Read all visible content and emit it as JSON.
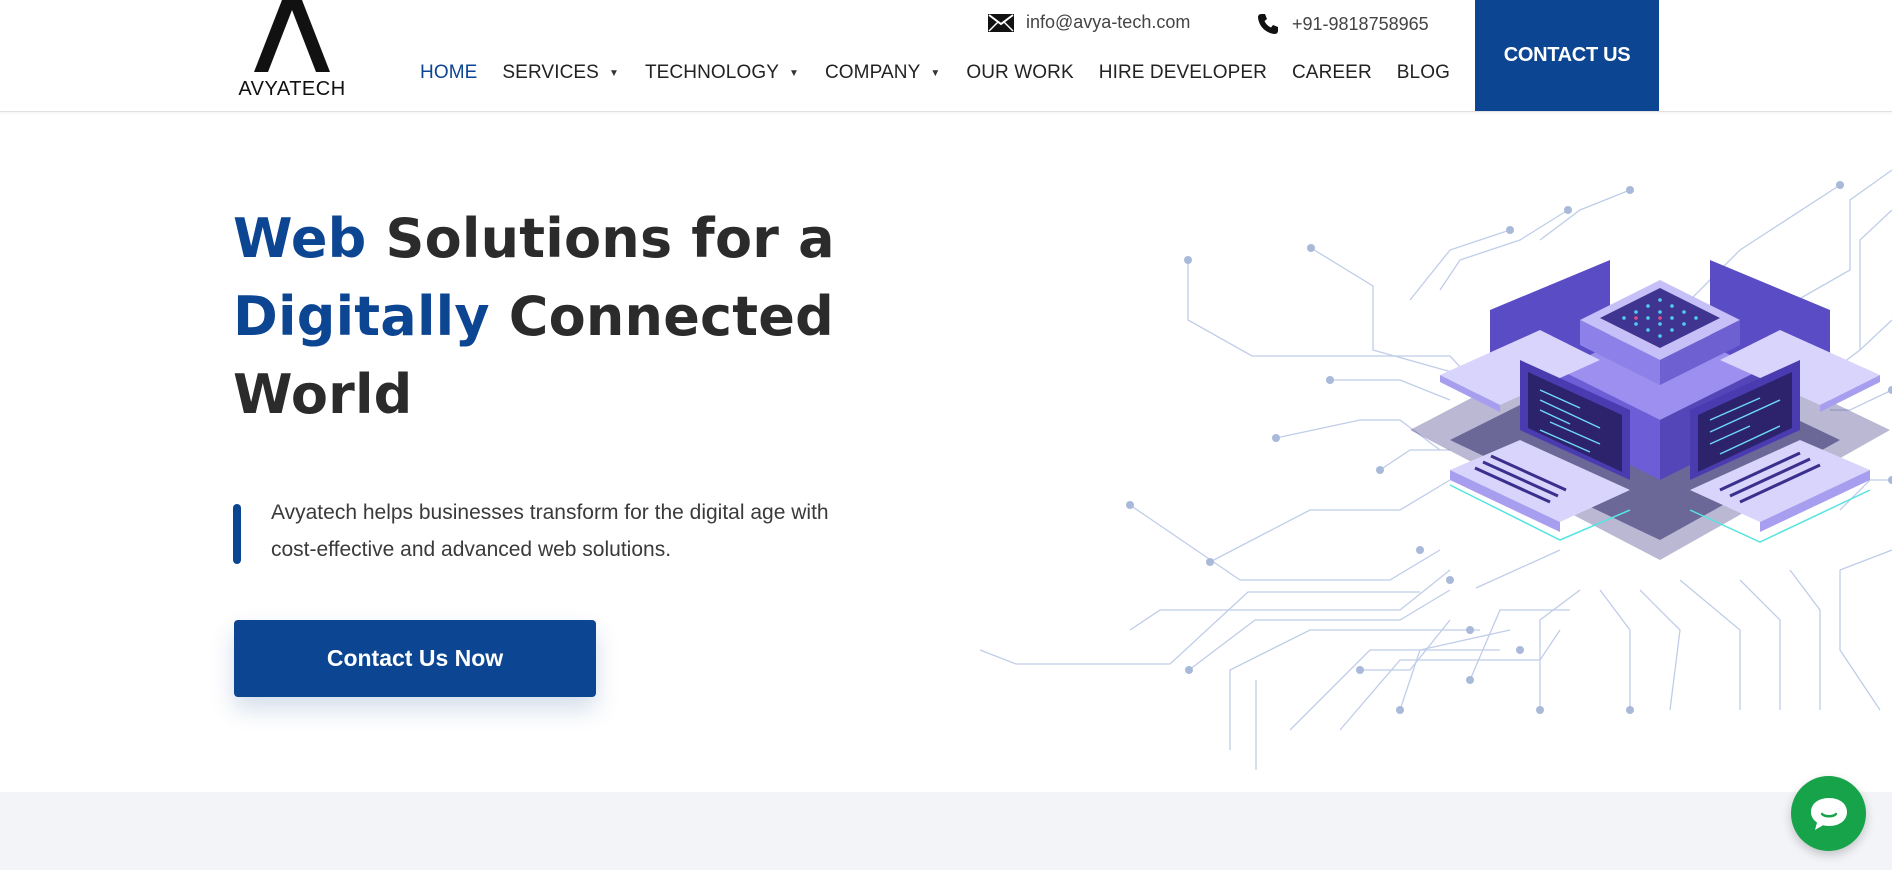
{
  "brand": {
    "logo_text": "AVYATECH"
  },
  "contact": {
    "email": "info@avya-tech.com",
    "phone": "+91-9818758965"
  },
  "nav": {
    "items": [
      {
        "label": "HOME",
        "active": true,
        "dropdown": false
      },
      {
        "label": "SERVICES",
        "active": false,
        "dropdown": true
      },
      {
        "label": "TECHNOLOGY",
        "active": false,
        "dropdown": true
      },
      {
        "label": "COMPANY",
        "active": false,
        "dropdown": true
      },
      {
        "label": "OUR WORK",
        "active": false,
        "dropdown": false
      },
      {
        "label": "HIRE DEVELOPER",
        "active": false,
        "dropdown": false
      },
      {
        "label": "CAREER",
        "active": false,
        "dropdown": false
      },
      {
        "label": "BLOG",
        "active": false,
        "dropdown": false
      }
    ],
    "caret_glyph": "▼",
    "cta_label": "CONTACT US"
  },
  "hero": {
    "title": {
      "line1_accent": "Web",
      "line1_rest": " Solutions for a",
      "line2_accent": "Digitally",
      "line2_rest": " Connected",
      "line3": "World"
    },
    "description_line1": "Avyatech helps businesses transform for the digital age with",
    "description_line2": "cost-effective and advanced web solutions.",
    "button_label": "Contact Us Now"
  },
  "icons": {
    "email": "mail-icon",
    "phone": "phone-icon",
    "chat": "chat-bubble-icon"
  },
  "colors": {
    "brand_blue": "#0c4591",
    "chat_green": "#17a34a",
    "text_dark": "#2b2b2b",
    "band_gray": "#f3f4f8"
  }
}
